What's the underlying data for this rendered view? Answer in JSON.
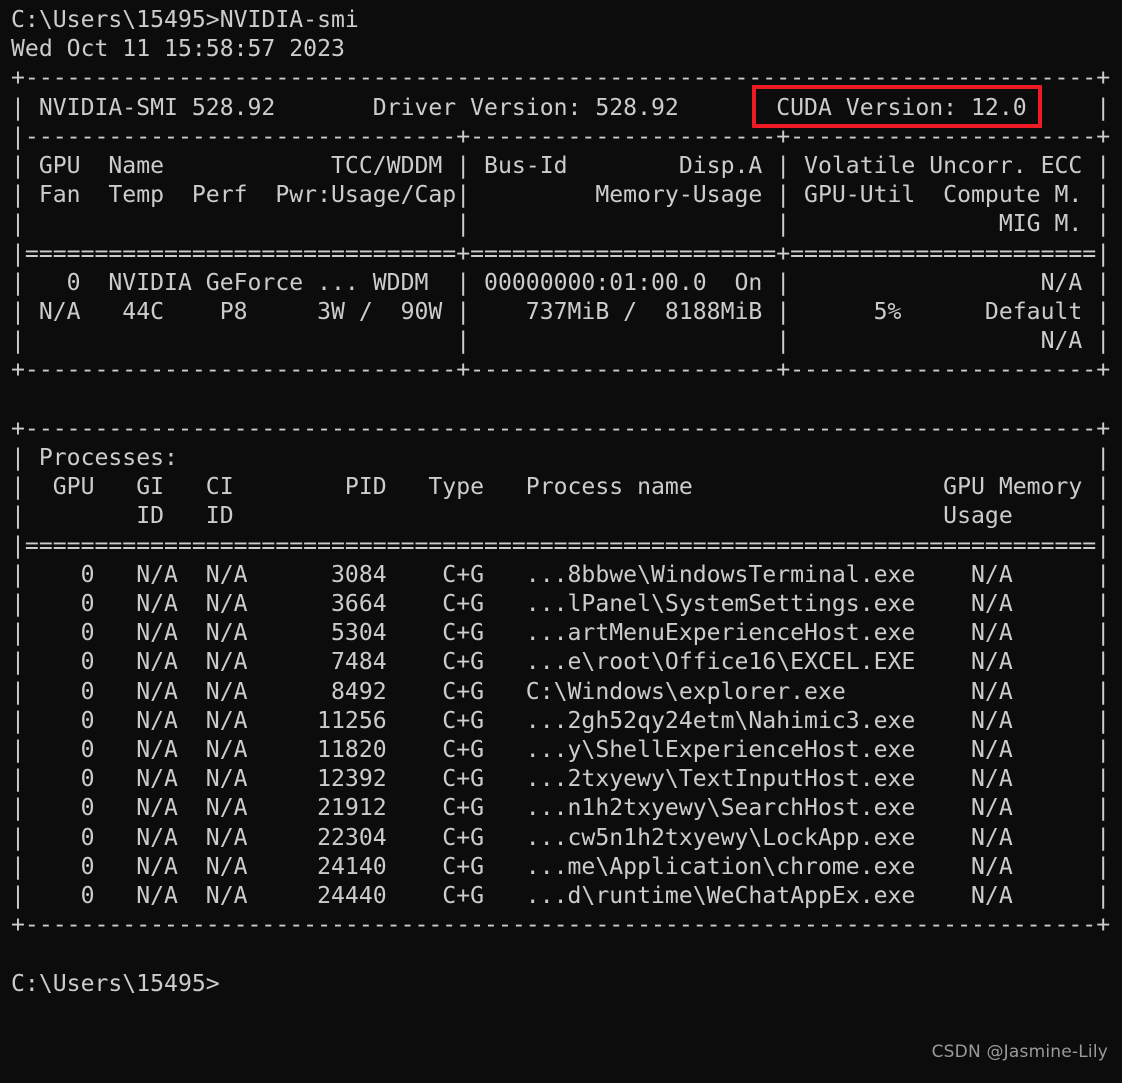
{
  "terminal": {
    "background_color": "#0c0c0c",
    "text_color": "#cccccc",
    "prompt_top": "C:\\Users\\15495>NVIDIA-smi",
    "timestamp": "Wed Oct 11 15:58:57 2023",
    "prompt_bottom": "C:\\Users\\15495>"
  },
  "annotation": {
    "highlight_color": "#ee1b24",
    "highlight_target": "CUDA Version: 12.0"
  },
  "watermark": {
    "text": "CSDN @Jasmine-Lily",
    "color": "#9a9a9a"
  },
  "smi_header": {
    "nvidia_smi_version": "NVIDIA-SMI 528.92",
    "driver_version_label": "Driver Version: 528.92",
    "cuda_version_label": "CUDA Version: 12.0"
  },
  "gpu_table": {
    "header_row_1": [
      "GPU",
      "Name",
      "TCC/WDDM",
      "Bus-Id",
      "Disp.A",
      "Volatile Uncorr. ECC"
    ],
    "header_row_2": [
      "Fan",
      "Temp",
      "Perf",
      "Pwr:Usage/Cap",
      "Memory-Usage",
      "GPU-Util",
      "Compute M."
    ],
    "header_row_3": [
      "MIG M."
    ],
    "rows": [
      {
        "gpu": "0",
        "name": "NVIDIA GeForce ...",
        "tcc_wddm": "WDDM",
        "bus_id": "00000000:01:00.0",
        "disp_a": "On",
        "ecc": "N/A",
        "fan": "N/A",
        "temp": "44C",
        "perf": "P8",
        "pwr_usage_cap": "3W /  90W",
        "memory_used": "737MiB",
        "memory_total": "8188MiB",
        "gpu_util": "5%",
        "compute_m": "Default",
        "mig_m": "N/A"
      }
    ]
  },
  "processes_table": {
    "title": "Processes:",
    "header_row_1": [
      "GPU",
      "GI",
      "CI",
      "PID",
      "Type",
      "Process name",
      "GPU Memory"
    ],
    "header_row_2": [
      "ID",
      "ID"
    ],
    "header_row_3": [
      "Usage"
    ],
    "rows": [
      {
        "gpu": "0",
        "gi_id": "N/A",
        "ci_id": "N/A",
        "pid": "3084",
        "type": "C+G",
        "process_name": "...8bbwe\\WindowsTerminal.exe",
        "gpu_memory_usage": "N/A"
      },
      {
        "gpu": "0",
        "gi_id": "N/A",
        "ci_id": "N/A",
        "pid": "3664",
        "type": "C+G",
        "process_name": "...lPanel\\SystemSettings.exe",
        "gpu_memory_usage": "N/A"
      },
      {
        "gpu": "0",
        "gi_id": "N/A",
        "ci_id": "N/A",
        "pid": "5304",
        "type": "C+G",
        "process_name": "...artMenuExperienceHost.exe",
        "gpu_memory_usage": "N/A"
      },
      {
        "gpu": "0",
        "gi_id": "N/A",
        "ci_id": "N/A",
        "pid": "7484",
        "type": "C+G",
        "process_name": "...e\\root\\Office16\\EXCEL.EXE",
        "gpu_memory_usage": "N/A"
      },
      {
        "gpu": "0",
        "gi_id": "N/A",
        "ci_id": "N/A",
        "pid": "8492",
        "type": "C+G",
        "process_name": "C:\\Windows\\explorer.exe",
        "gpu_memory_usage": "N/A"
      },
      {
        "gpu": "0",
        "gi_id": "N/A",
        "ci_id": "N/A",
        "pid": "11256",
        "type": "C+G",
        "process_name": "...2gh52qy24etm\\Nahimic3.exe",
        "gpu_memory_usage": "N/A"
      },
      {
        "gpu": "0",
        "gi_id": "N/A",
        "ci_id": "N/A",
        "pid": "11820",
        "type": "C+G",
        "process_name": "...y\\ShellExperienceHost.exe",
        "gpu_memory_usage": "N/A"
      },
      {
        "gpu": "0",
        "gi_id": "N/A",
        "ci_id": "N/A",
        "pid": "12392",
        "type": "C+G",
        "process_name": "...2txyewy\\TextInputHost.exe",
        "gpu_memory_usage": "N/A"
      },
      {
        "gpu": "0",
        "gi_id": "N/A",
        "ci_id": "N/A",
        "pid": "21912",
        "type": "C+G",
        "process_name": "...n1h2txyewy\\SearchHost.exe",
        "gpu_memory_usage": "N/A"
      },
      {
        "gpu": "0",
        "gi_id": "N/A",
        "ci_id": "N/A",
        "pid": "22304",
        "type": "C+G",
        "process_name": "...cw5n1h2txyewy\\LockApp.exe",
        "gpu_memory_usage": "N/A"
      },
      {
        "gpu": "0",
        "gi_id": "N/A",
        "ci_id": "N/A",
        "pid": "24140",
        "type": "C+G",
        "process_name": "...me\\Application\\chrome.exe",
        "gpu_memory_usage": "N/A"
      },
      {
        "gpu": "0",
        "gi_id": "N/A",
        "ci_id": "N/A",
        "pid": "24440",
        "type": "C+G",
        "process_name": "...d\\runtime\\WeChatAppEx.exe",
        "gpu_memory_usage": "N/A"
      }
    ]
  },
  "console_text": "C:\\Users\\15495>NVIDIA-smi\nWed Oct 11 15:58:57 2023\n+-----------------------------------------------------------------------------+\n| NVIDIA-SMI 528.92       Driver Version: 528.92       CUDA Version: 12.0     |\n|-------------------------------+----------------------+----------------------+\n| GPU  Name            TCC/WDDM | Bus-Id        Disp.A | Volatile Uncorr. ECC |\n| Fan  Temp  Perf  Pwr:Usage/Cap|         Memory-Usage | GPU-Util  Compute M. |\n|                               |                      |               MIG M. |\n|===============================+======================+======================|\n|   0  NVIDIA GeForce ... WDDM  | 00000000:01:00.0  On |                  N/A |\n| N/A   44C    P8     3W /  90W |    737MiB /  8188MiB |      5%      Default |\n|                               |                      |                  N/A |\n+-------------------------------+----------------------+----------------------+\n                                                                               \n+-----------------------------------------------------------------------------+\n| Processes:                                                                  |\n|  GPU   GI   CI        PID   Type   Process name                  GPU Memory |\n|        ID   ID                                                   Usage      |\n|=============================================================================|\n|    0   N/A  N/A      3084    C+G   ...8bbwe\\WindowsTerminal.exe    N/A      |\n|    0   N/A  N/A      3664    C+G   ...lPanel\\SystemSettings.exe    N/A      |\n|    0   N/A  N/A      5304    C+G   ...artMenuExperienceHost.exe    N/A      |\n|    0   N/A  N/A      7484    C+G   ...e\\root\\Office16\\EXCEL.EXE    N/A      |\n|    0   N/A  N/A      8492    C+G   C:\\Windows\\explorer.exe         N/A      |\n|    0   N/A  N/A     11256    C+G   ...2gh52qy24etm\\Nahimic3.exe    N/A      |\n|    0   N/A  N/A     11820    C+G   ...y\\ShellExperienceHost.exe    N/A      |\n|    0   N/A  N/A     12392    C+G   ...2txyewy\\TextInputHost.exe    N/A      |\n|    0   N/A  N/A     21912    C+G   ...n1h2txyewy\\SearchHost.exe    N/A      |\n|    0   N/A  N/A     22304    C+G   ...cw5n1h2txyewy\\LockApp.exe    N/A      |\n|    0   N/A  N/A     24140    C+G   ...me\\Application\\chrome.exe    N/A      |\n|    0   N/A  N/A     24440    C+G   ...d\\runtime\\WeChatAppEx.exe    N/A      |\n+-----------------------------------------------------------------------------+\n\nC:\\Users\\15495>"
}
